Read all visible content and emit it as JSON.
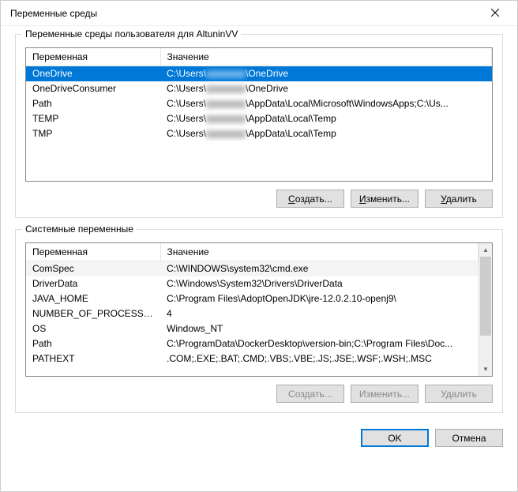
{
  "titlebar": {
    "title": "Переменные среды"
  },
  "user_group": {
    "label": "Переменные среды пользователя для AltuninVV",
    "columns": {
      "name": "Переменная",
      "value": "Значение"
    },
    "rows": [
      {
        "name": "OneDrive",
        "prefix": "C:\\Users\\",
        "redacted": true,
        "suffix": "\\OneDrive",
        "selected": true
      },
      {
        "name": "OneDriveConsumer",
        "prefix": "C:\\Users\\",
        "redacted": true,
        "suffix": "\\OneDrive"
      },
      {
        "name": "Path",
        "prefix": "C:\\Users\\",
        "redacted": true,
        "suffix": "\\AppData\\Local\\Microsoft\\WindowsApps;C:\\Us..."
      },
      {
        "name": "TEMP",
        "prefix": "C:\\Users\\",
        "redacted": true,
        "suffix": "\\AppData\\Local\\Temp"
      },
      {
        "name": "TMP",
        "prefix": "C:\\Users\\",
        "redacted": true,
        "suffix": "\\AppData\\Local\\Temp"
      }
    ],
    "buttons": {
      "new": "Создать...",
      "edit": "Изменить...",
      "delete": "Удалить"
    },
    "mnemonics": {
      "new_u": "С",
      "edit_u": "И",
      "delete_u": "У"
    }
  },
  "system_group": {
    "label": "Системные переменные",
    "columns": {
      "name": "Переменная",
      "value": "Значение"
    },
    "rows": [
      {
        "name": "ComSpec",
        "value": "C:\\WINDOWS\\system32\\cmd.exe",
        "striped": true
      },
      {
        "name": "DriverData",
        "value": "C:\\Windows\\System32\\Drivers\\DriverData"
      },
      {
        "name": "JAVA_HOME",
        "value": "C:\\Program Files\\AdoptOpenJDK\\jre-12.0.2.10-openj9\\"
      },
      {
        "name": "NUMBER_OF_PROCESSORS",
        "value": "4"
      },
      {
        "name": "OS",
        "value": "Windows_NT"
      },
      {
        "name": "Path",
        "value": "C:\\ProgramData\\DockerDesktop\\version-bin;C:\\Program Files\\Doc..."
      },
      {
        "name": "PATHEXT",
        "value": ".COM;.EXE;.BAT;.CMD;.VBS;.VBE;.JS;.JSE;.WSF;.WSH;.MSC"
      }
    ],
    "buttons": {
      "new": "Создать...",
      "edit": "Изменить...",
      "delete": "Удалить"
    }
  },
  "footer": {
    "ok": "OK",
    "cancel": "Отмена"
  }
}
